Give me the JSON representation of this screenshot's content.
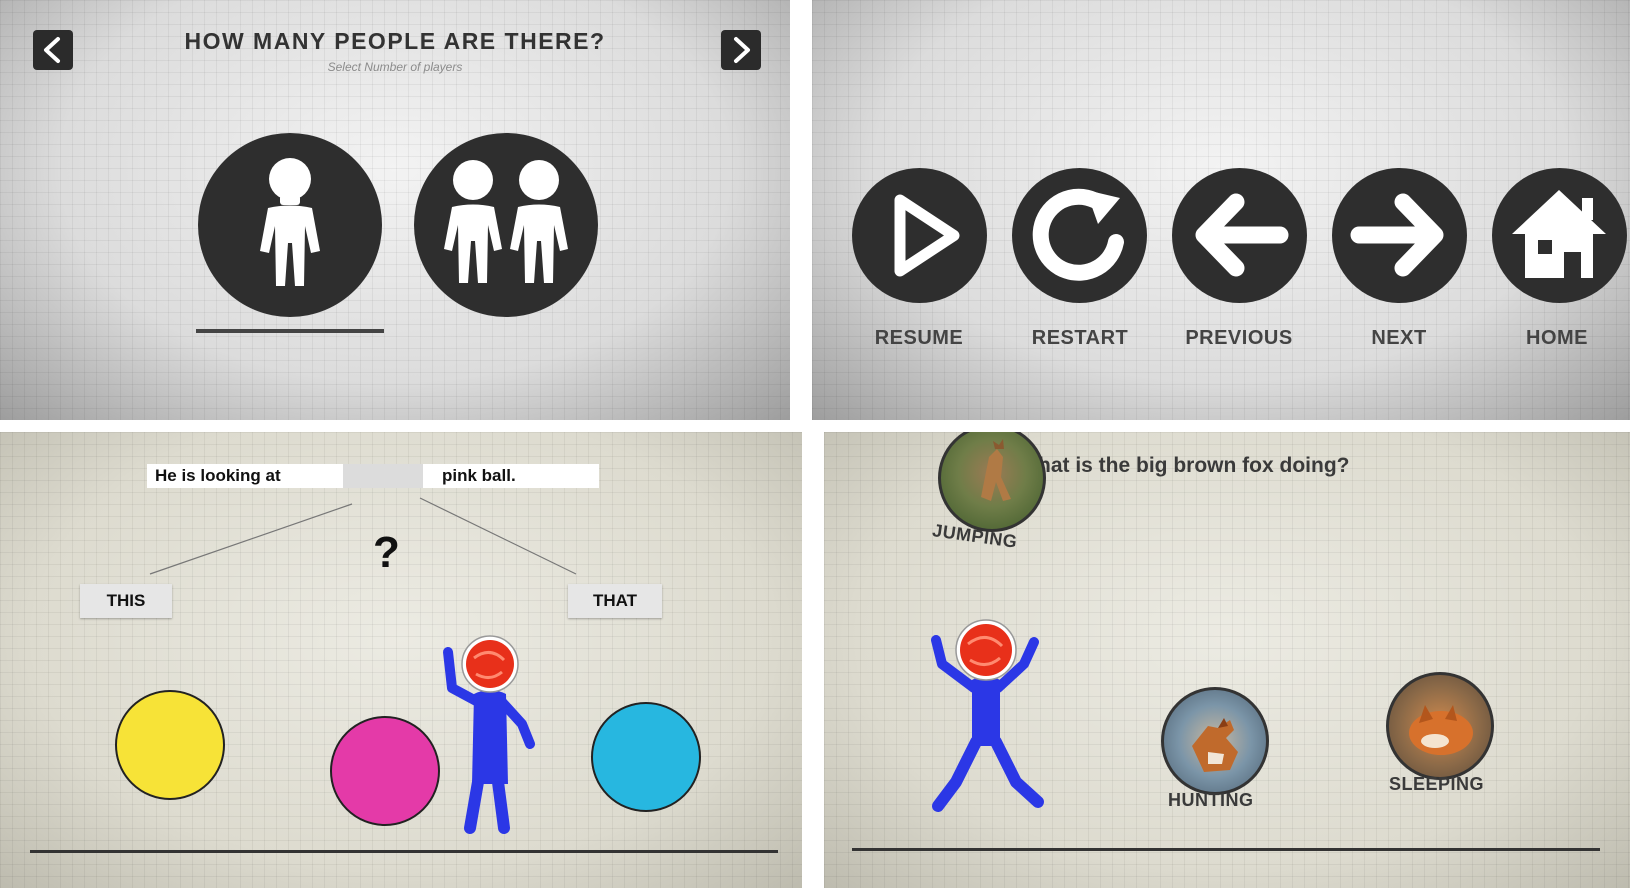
{
  "panel1": {
    "title": "HOW MANY PEOPLE ARE THERE?",
    "subtitle": "Select Number of players",
    "options": [
      {
        "players": 1,
        "selected": true
      },
      {
        "players": 2,
        "selected": false
      }
    ]
  },
  "panel2": {
    "buttons": [
      {
        "label": "RESUME",
        "icon": "play-icon"
      },
      {
        "label": "RESTART",
        "icon": "restart-icon"
      },
      {
        "label": "PREVIOUS",
        "icon": "arrow-left-icon"
      },
      {
        "label": "NEXT",
        "icon": "arrow-right-icon"
      },
      {
        "label": "HOME",
        "icon": "home-icon"
      }
    ]
  },
  "panel3": {
    "sentence_part1": "He is looking at",
    "sentence_part2": "pink ball.",
    "question_mark": "?",
    "choices": [
      "THIS",
      "THAT"
    ],
    "balls": [
      {
        "color": "#f7e337"
      },
      {
        "color": "#e43aa8"
      },
      {
        "color": "#27b7e0"
      }
    ]
  },
  "panel4": {
    "question": "hat is the big brown fox doing?",
    "answers": [
      "JUMPING",
      "HUNTING",
      "SLEEPING"
    ]
  },
  "colors": {
    "dark_icon": "#2e2e2e",
    "avatar_blue": "#2b37e6",
    "avatar_red": "#e8301a"
  }
}
